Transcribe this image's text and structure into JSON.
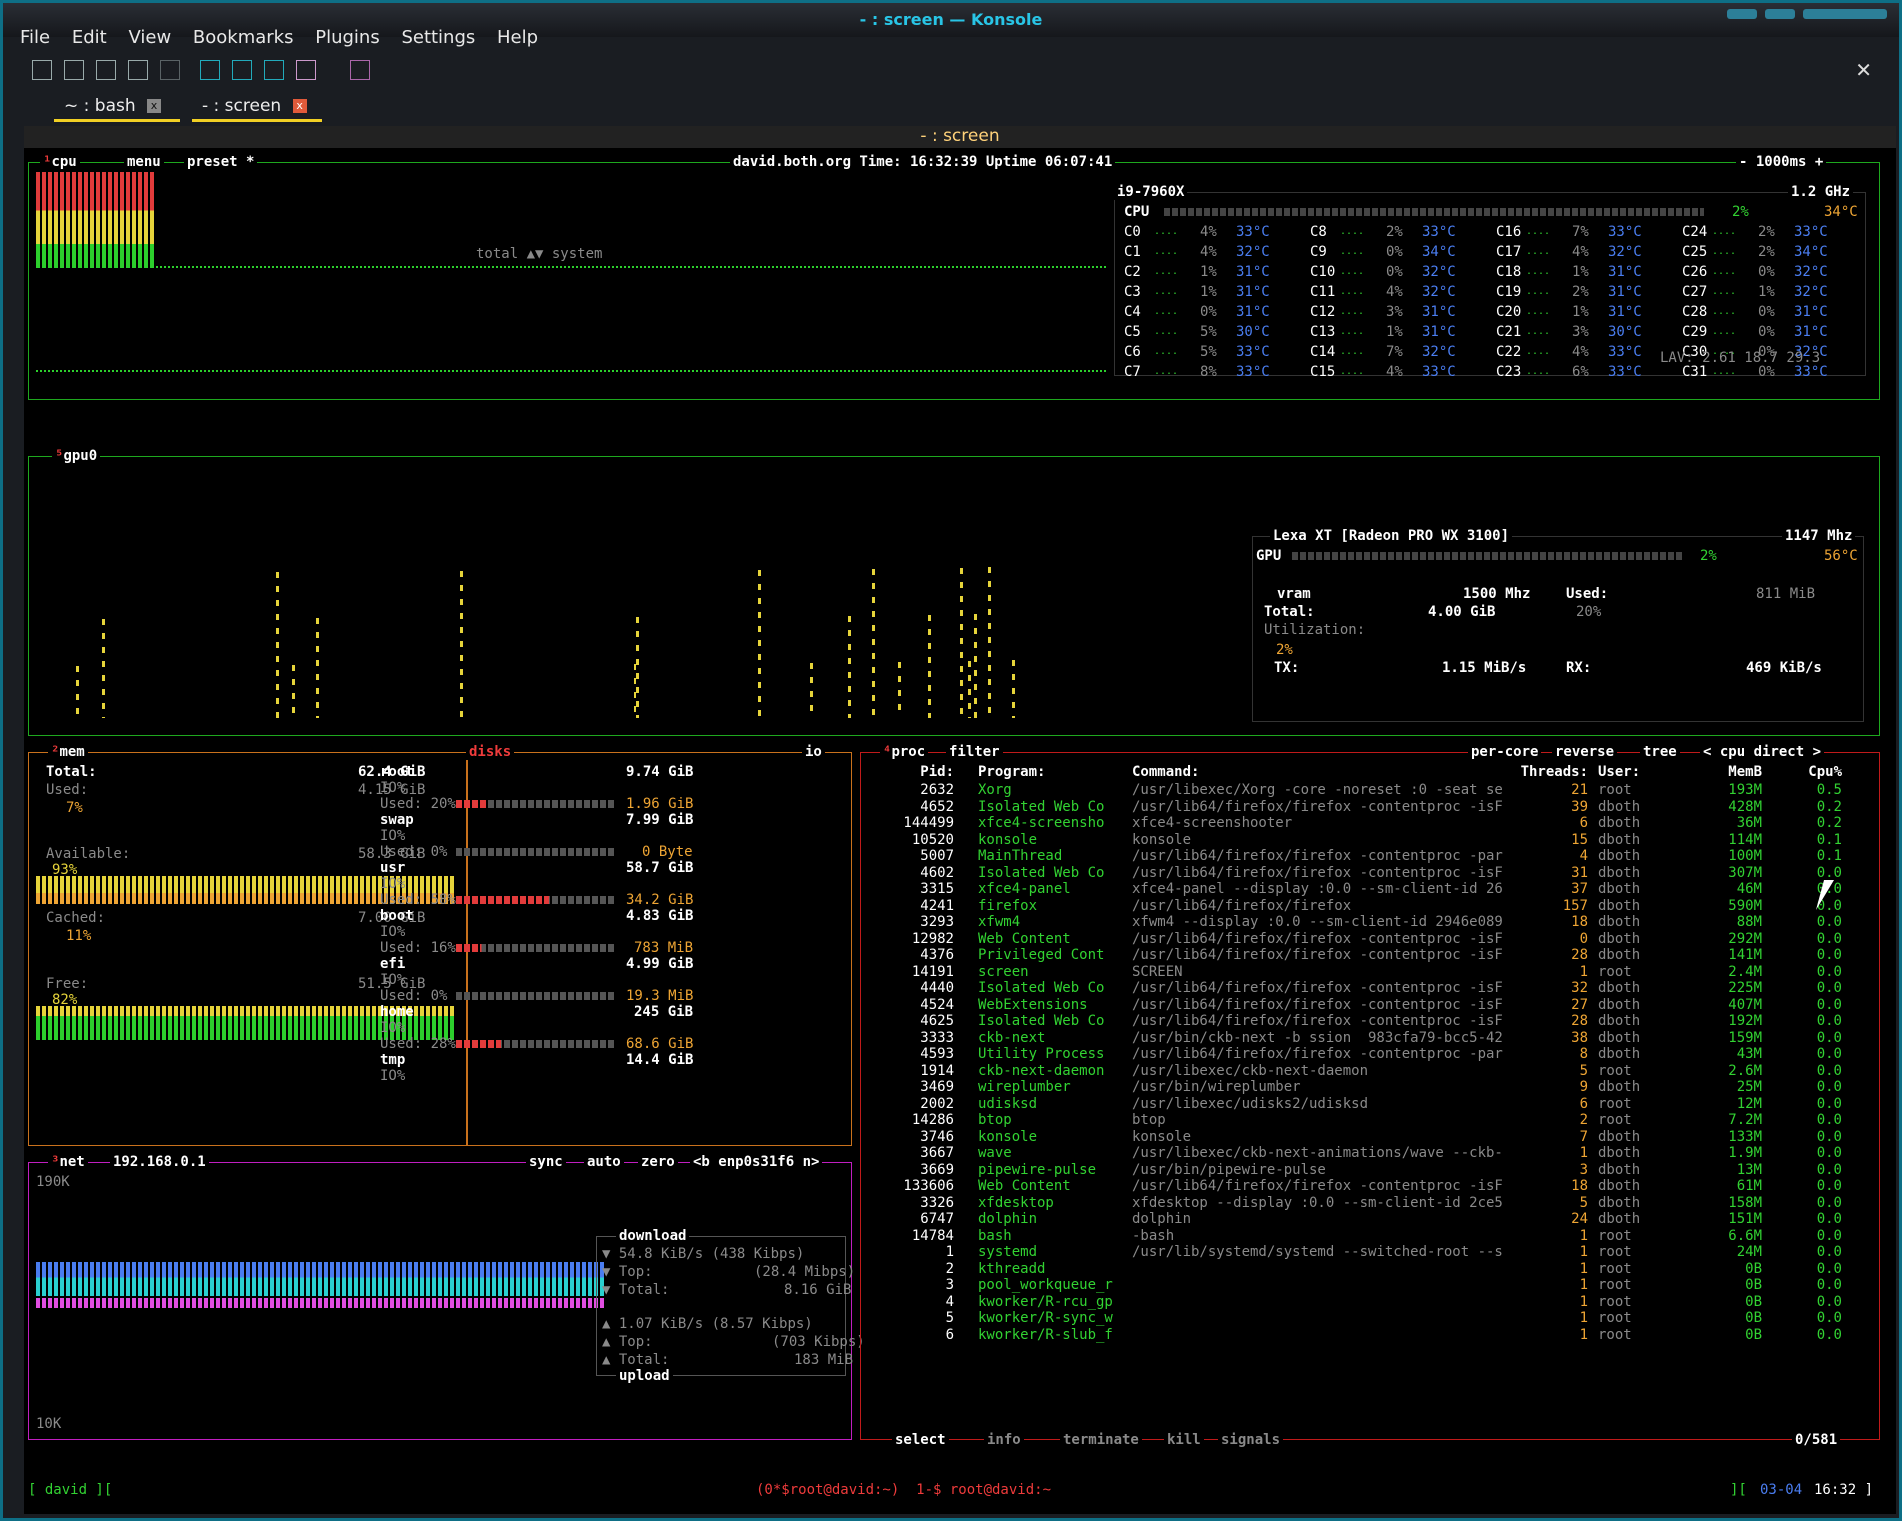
{
  "window": {
    "title": "- : screen — Konsole"
  },
  "menu": [
    "File",
    "Edit",
    "View",
    "Bookmarks",
    "Plugins",
    "Settings",
    "Help"
  ],
  "tabs": [
    {
      "label": "~ : bash"
    },
    {
      "label": "- : screen"
    }
  ],
  "session_title": "- : screen",
  "cpu": {
    "label": "cpu",
    "menu": "menu",
    "preset": "preset *",
    "header": "david.both.org Time: 16:32:39  Uptime 06:07:41",
    "interval": "- 1000ms +",
    "mode_label": "total ▲▼ system",
    "model": "i9-7960X",
    "freq": "1.2 GHz",
    "total": {
      "name": "CPU",
      "pct": "2%",
      "temp": "34°C"
    },
    "cores": [
      [
        "C0",
        "4%",
        "33°C"
      ],
      [
        "C1",
        "4%",
        "32°C"
      ],
      [
        "C2",
        "1%",
        "31°C"
      ],
      [
        "C3",
        "1%",
        "31°C"
      ],
      [
        "C4",
        "0%",
        "31°C"
      ],
      [
        "C5",
        "5%",
        "30°C"
      ],
      [
        "C6",
        "5%",
        "33°C"
      ],
      [
        "C7",
        "8%",
        "33°C"
      ],
      [
        "C8",
        "2%",
        "33°C"
      ],
      [
        "C9",
        "0%",
        "34°C"
      ],
      [
        "C10",
        "0%",
        "32°C"
      ],
      [
        "C11",
        "4%",
        "32°C"
      ],
      [
        "C12",
        "3%",
        "31°C"
      ],
      [
        "C13",
        "1%",
        "31°C"
      ],
      [
        "C14",
        "7%",
        "32°C"
      ],
      [
        "C15",
        "4%",
        "33°C"
      ],
      [
        "C16",
        "7%",
        "33°C"
      ],
      [
        "C17",
        "4%",
        "32°C"
      ],
      [
        "C18",
        "1%",
        "31°C"
      ],
      [
        "C19",
        "2%",
        "31°C"
      ],
      [
        "C20",
        "1%",
        "31°C"
      ],
      [
        "C21",
        "3%",
        "30°C"
      ],
      [
        "C22",
        "4%",
        "33°C"
      ],
      [
        "C23",
        "6%",
        "33°C"
      ],
      [
        "C24",
        "2%",
        "33°C"
      ],
      [
        "C25",
        "2%",
        "34°C"
      ],
      [
        "C26",
        "0%",
        "32°C"
      ],
      [
        "C27",
        "1%",
        "32°C"
      ],
      [
        "C28",
        "0%",
        "31°C"
      ],
      [
        "C29",
        "0%",
        "31°C"
      ],
      [
        "C30",
        "0%",
        "32°C"
      ],
      [
        "C31",
        "0%",
        "33°C"
      ]
    ],
    "lav": "LAV: 2.61 18.7 29.3"
  },
  "gpu": {
    "label": "gpu0",
    "model": "Lexa XT [Radeon PRO WX 3100]",
    "freq": "1147 Mhz",
    "gpu_pct": "2%",
    "gpu_temp": "56°C",
    "vram": "vram",
    "vram_freq": "1500 Mhz",
    "used_label": "Used:",
    "used_val": "811 MiB",
    "total_label": "Total:",
    "total_val": "4.00 GiB",
    "used_pct": "20%",
    "util_label": "Utilization:",
    "util_pct": "2%",
    "tx_label": "TX:",
    "tx_val": "1.15 MiB/s",
    "rx_label": "RX:",
    "rx_val": "469 KiB/s"
  },
  "mem": {
    "label": "mem",
    "total_label": "Total:",
    "total": "62.4 GiB",
    "used_label": "Used:",
    "used": "4.15 GiB",
    "used_pct": "7%",
    "avail_label": "Available:",
    "avail": "58.3 GiB",
    "avail_pct": "93%",
    "cached_label": "Cached:",
    "cached": "7.00 GiB",
    "cached_pct": "11%",
    "free_label": "Free:",
    "free": "51.5 GiB",
    "free_pct": "82%"
  },
  "disks": {
    "label": "disks",
    "io": "io",
    "items": [
      {
        "name": "root",
        "size": "9.74 GiB",
        "used_pct": "20%",
        "used": "1.96 GiB",
        "frac": 0.2
      },
      {
        "name": "swap",
        "size": "7.99 GiB",
        "used_pct": "0%",
        "used": "0 Byte",
        "frac": 0
      },
      {
        "name": "usr",
        "size": "58.7 GiB",
        "used_pct": "58%",
        "used": "34.2 GiB",
        "frac": 0.58
      },
      {
        "name": "boot",
        "size": "4.83 GiB",
        "used_pct": "16%",
        "used": "783 MiB",
        "frac": 0.16
      },
      {
        "name": "efi",
        "size": "4.99 GiB",
        "used_pct": "0%",
        "used": "19.3 MiB",
        "frac": 0
      },
      {
        "name": "home",
        "size": "245 GiB",
        "used_pct": "28%",
        "used": "68.6 GiB",
        "frac": 0.28
      },
      {
        "name": "tmp",
        "size": "14.4 GiB"
      }
    ],
    "io_label": "IO%",
    "used_label": "Used:"
  },
  "net": {
    "label": "net",
    "ip": "192.168.0.1",
    "sync": "sync",
    "auto": "auto",
    "zero": "zero",
    "iface": "<b enp0s31f6 n>",
    "top_scale": "190K",
    "bottom_scale": "10K",
    "download": "download",
    "upload": "upload",
    "down_rate": "54.8 KiB/s",
    "down_rate_b": "(438 Kibps)",
    "down_top": "(28.4 Mibps)",
    "down_total": "8.16 GiB",
    "up_rate": "1.07 KiB/s",
    "up_rate_b": "(8.57 Kibps)",
    "up_top": "(703 Kibps)",
    "up_total": "183 MiB",
    "top_label": "Top:",
    "total_label": "Total:"
  },
  "proc": {
    "label": "proc",
    "filter": "filter",
    "per_core": "per-core",
    "reverse": "reverse",
    "tree": "tree",
    "sort": "< cpu direct >",
    "headers": [
      "Pid:",
      "Program:",
      "Command:",
      "Threads:",
      "User:",
      "MemB",
      "Cpu%"
    ],
    "rows": [
      [
        "2632",
        "Xorg",
        "/usr/libexec/Xorg -core -noreset :0 -seat se",
        "21",
        "root",
        "193M",
        "0.5"
      ],
      [
        "4652",
        "Isolated Web Co",
        "/usr/lib64/firefox/firefox -contentproc -isF",
        "39",
        "dboth",
        "428M",
        "0.2"
      ],
      [
        "144499",
        "xfce4-screensho",
        "xfce4-screenshooter",
        "6",
        "dboth",
        "36M",
        "0.2"
      ],
      [
        "10520",
        "konsole",
        "konsole",
        "15",
        "dboth",
        "114M",
        "0.1"
      ],
      [
        "5007",
        "MainThread",
        "/usr/lib64/firefox/firefox -contentproc -par",
        "4",
        "dboth",
        "100M",
        "0.1"
      ],
      [
        "4602",
        "Isolated Web Co",
        "/usr/lib64/firefox/firefox -contentproc -isF",
        "31",
        "dboth",
        "307M",
        "0.0"
      ],
      [
        "3315",
        "xfce4-panel",
        "xfce4-panel --display :0.0 --sm-client-id 26",
        "37",
        "dboth",
        "46M",
        "0.0"
      ],
      [
        "4241",
        "firefox",
        "/usr/lib64/firefox/firefox",
        "157",
        "dboth",
        "590M",
        "0.0"
      ],
      [
        "3293",
        "xfwm4",
        "xfwm4 --display :0.0 --sm-client-id 2946e089",
        "18",
        "dboth",
        "88M",
        "0.0"
      ],
      [
        "12982",
        "Web Content",
        "/usr/lib64/firefox/firefox -contentproc -isF",
        "0",
        "dboth",
        "292M",
        "0.0"
      ],
      [
        "4376",
        "Privileged Cont",
        "/usr/lib64/firefox/firefox -contentproc -isF",
        "28",
        "dboth",
        "141M",
        "0.0"
      ],
      [
        "14191",
        "screen",
        "SCREEN",
        "1",
        "root",
        "2.4M",
        "0.0"
      ],
      [
        "4440",
        "Isolated Web Co",
        "/usr/lib64/firefox/firefox -contentproc -isF",
        "32",
        "dboth",
        "225M",
        "0.0"
      ],
      [
        "4524",
        "WebExtensions",
        "/usr/lib64/firefox/firefox -contentproc -isF",
        "27",
        "dboth",
        "407M",
        "0.0"
      ],
      [
        "4625",
        "Isolated Web Co",
        "/usr/lib64/firefox/firefox -contentproc -isF",
        "28",
        "dboth",
        "192M",
        "0.0"
      ],
      [
        "3333",
        "ckb-next",
        "/usr/bin/ckb-next -b ssion  983cfa79-bcc5-42",
        "38",
        "dboth",
        "159M",
        "0.0"
      ],
      [
        "4593",
        "Utility Process",
        "/usr/lib64/firefox/firefox -contentproc -par",
        "8",
        "dboth",
        "43M",
        "0.0"
      ],
      [
        "1914",
        "ckb-next-daemon",
        "/usr/libexec/ckb-next-daemon",
        "5",
        "root",
        "2.6M",
        "0.0"
      ],
      [
        "3469",
        "wireplumber",
        "/usr/bin/wireplumber",
        "9",
        "dboth",
        "25M",
        "0.0"
      ],
      [
        "2002",
        "udisksd",
        "/usr/libexec/udisks2/udisksd",
        "6",
        "root",
        "12M",
        "0.0"
      ],
      [
        "14286",
        "btop",
        "btop",
        "2",
        "root",
        "7.2M",
        "0.0"
      ],
      [
        "3746",
        "konsole",
        "konsole",
        "7",
        "dboth",
        "133M",
        "0.0"
      ],
      [
        "3667",
        "wave",
        "/usr/libexec/ckb-next-animations/wave --ckb-",
        "1",
        "dboth",
        "1.9M",
        "0.0"
      ],
      [
        "3669",
        "pipewire-pulse",
        "/usr/bin/pipewire-pulse",
        "3",
        "dboth",
        "13M",
        "0.0"
      ],
      [
        "133606",
        "Web Content",
        "/usr/lib64/firefox/firefox -contentproc -isF",
        "18",
        "dboth",
        "61M",
        "0.0"
      ],
      [
        "3326",
        "xfdesktop",
        "xfdesktop --display :0.0 --sm-client-id 2ce5",
        "5",
        "dboth",
        "158M",
        "0.0"
      ],
      [
        "6747",
        "dolphin",
        "dolphin",
        "24",
        "dboth",
        "151M",
        "0.0"
      ],
      [
        "14784",
        "bash",
        "-bash",
        "1",
        "root",
        "6.6M",
        "0.0"
      ],
      [
        "1",
        "systemd",
        "/usr/lib/systemd/systemd --switched-root --s",
        "1",
        "root",
        "24M",
        "0.0"
      ],
      [
        "2",
        "kthreadd",
        "",
        "1",
        "root",
        "0B",
        "0.0"
      ],
      [
        "3",
        "pool_workqueue_r",
        "",
        "1",
        "root",
        "0B",
        "0.0"
      ],
      [
        "4",
        "kworker/R-rcu_gp",
        "",
        "1",
        "root",
        "0B",
        "0.0"
      ],
      [
        "5",
        "kworker/R-sync_w",
        "",
        "1",
        "root",
        "0B",
        "0.0"
      ],
      [
        "6",
        "kworker/R-slub_f",
        "",
        "1",
        "root",
        "0B",
        "0.0"
      ]
    ],
    "footer": {
      "select": "select",
      "info": "info",
      "terminate": "terminate",
      "kill": "kill",
      "signals": "signals",
      "count": "0/581"
    }
  },
  "statusbar": {
    "left": "[ david ][",
    "center": "(0*$root@david:~)  1-$ root@david:~",
    "right_bracket": "][",
    "date": "03-04",
    "time": "16:32 ]"
  }
}
